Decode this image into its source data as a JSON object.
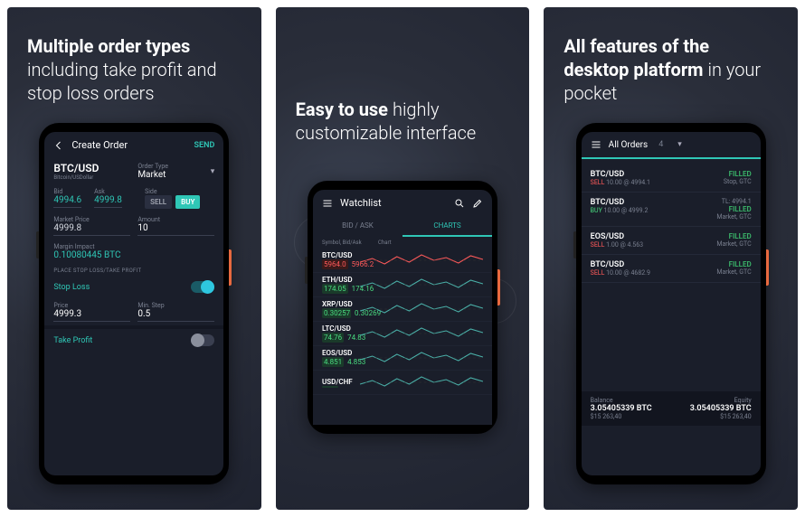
{
  "panels": [
    {
      "title_bold": "Multiple order types",
      "title_light": "including take profit and stop loss orders"
    },
    {
      "title_bold": "Easy to use",
      "title_light": "highly customizable interface"
    },
    {
      "title_bold": "All features of the desktop platform",
      "title_light": "in your pocket"
    }
  ],
  "create_order": {
    "header": {
      "title": "Create Order",
      "send_label": "SEND"
    },
    "pair": "BTC/USD",
    "pair_sub": "Bitcoin/USDollar",
    "order_type_label": "Order Type",
    "order_type": "Market",
    "bid_label": "Bid",
    "bid": "4994.6",
    "ask_label": "Ask",
    "ask": "4999.8",
    "side_label": "Side",
    "sell_label": "SELL",
    "buy_label": "BUY",
    "market_price_label": "Market Price",
    "market_price": "4999.8",
    "amount_label": "Amount",
    "amount": "10",
    "margin_impact_label": "Margin Impact",
    "margin_impact": "0.10080445 BTC",
    "sltp_section": "PLACE STOP LOSS/TAKE PROFIT",
    "stop_loss_label": "Stop Loss",
    "price_label": "Price",
    "sl_price": "4999.3",
    "min_step_label": "Min. Step",
    "sl_min_step": "0.5",
    "take_profit_label": "Take Profit"
  },
  "watchlist": {
    "title": "Watchlist",
    "tab_bidask": "BID / ASK",
    "tab_charts": "CHARTS",
    "col_symbol": "Symbol, Bid/Ask",
    "col_chart": "Chart",
    "rows": [
      {
        "sym": "BTC/USD",
        "bid": "5964.0",
        "ask": "5966.2",
        "dir": "down"
      },
      {
        "sym": "ETH/USD",
        "bid": "174.05",
        "ask": "174.16",
        "dir": "up"
      },
      {
        "sym": "XRP/USD",
        "bid": "0.30257",
        "ask": "0.30269",
        "dir": "up"
      },
      {
        "sym": "LTC/USD",
        "bid": "74.76",
        "ask": "74.83",
        "dir": "up"
      },
      {
        "sym": "EOS/USD",
        "bid": "4.851",
        "ask": "4.853",
        "dir": "up"
      },
      {
        "sym": "USD/CHF",
        "bid": "",
        "ask": "",
        "dir": "up"
      }
    ]
  },
  "all_orders": {
    "title": "All Orders",
    "count": "4",
    "items": [
      {
        "sym": "BTC/USD",
        "side": "SELL",
        "qty": "10.00",
        "at": "4994.1",
        "status": "FILLED",
        "sub": "Stop, GTC"
      },
      {
        "sym": "BTC/USD",
        "side": "BUY",
        "qty": "10.00",
        "at": "4999.2",
        "tp": "TL: 4994.1",
        "status": "FILLED",
        "sub": "Market, GTC"
      },
      {
        "sym": "EOS/USD",
        "side": "SELL",
        "qty": "1.00",
        "at": "4.563",
        "status": "FILLED",
        "sub": "Market, GTC"
      },
      {
        "sym": "BTC/USD",
        "side": "SELL",
        "qty": "10.00",
        "at": "4682.9",
        "status": "FILLED",
        "sub": "Market, GTC"
      }
    ],
    "balance_label": "Balance",
    "equity_label": "Equity",
    "balance": "3.05405339 BTC",
    "balance_usd": "$15 263,40",
    "equity": "3.05405339 BTC",
    "equity_usd": "$15 263,40"
  }
}
